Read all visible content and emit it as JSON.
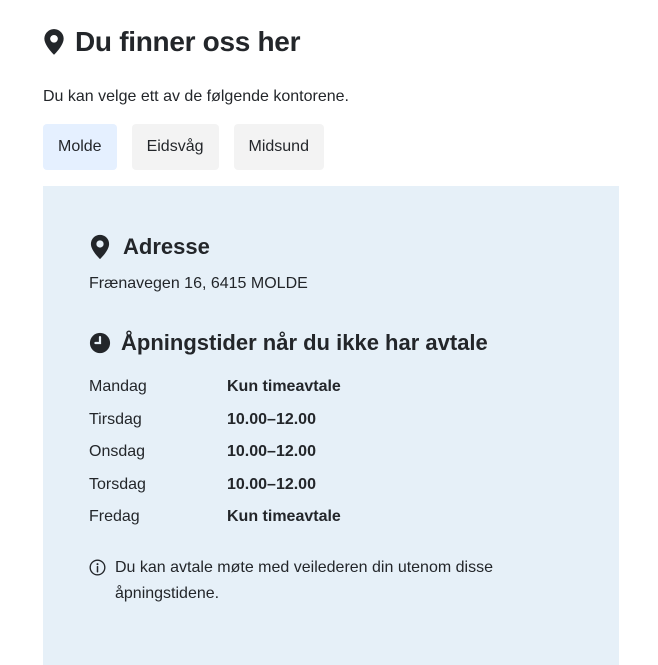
{
  "heading": {
    "icon": "location-pin-icon",
    "title": "Du finner oss her"
  },
  "intro": "Du kan velge ett av de følgende kontorene.",
  "offices": [
    {
      "label": "Molde",
      "selected": true
    },
    {
      "label": "Eidsvåg",
      "selected": false
    },
    {
      "label": "Midsund",
      "selected": false
    }
  ],
  "address": {
    "icon": "location-pin-icon",
    "heading": "Adresse",
    "text": "Frænavegen 16, 6415 MOLDE"
  },
  "opening_hours": {
    "icon": "clock-icon",
    "heading": "Åpningstider når du ikke har avtale",
    "rows": [
      {
        "day": "Mandag",
        "time": "Kun timeavtale"
      },
      {
        "day": "Tirsdag",
        "time": "10.00–12.00"
      },
      {
        "day": "Onsdag",
        "time": "10.00–12.00"
      },
      {
        "day": "Torsdag",
        "time": "10.00–12.00"
      },
      {
        "day": "Fredag",
        "time": "Kun timeavtale"
      }
    ]
  },
  "note": {
    "icon": "info-icon",
    "text": "Du kan avtale møte med veilederen din utenom disse åpningstidene."
  },
  "colors": {
    "text": "#23262a",
    "panel_background": "#e6f0f8",
    "selected_tab_background": "#e5f0ff",
    "tab_background": "#f3f3f3"
  }
}
